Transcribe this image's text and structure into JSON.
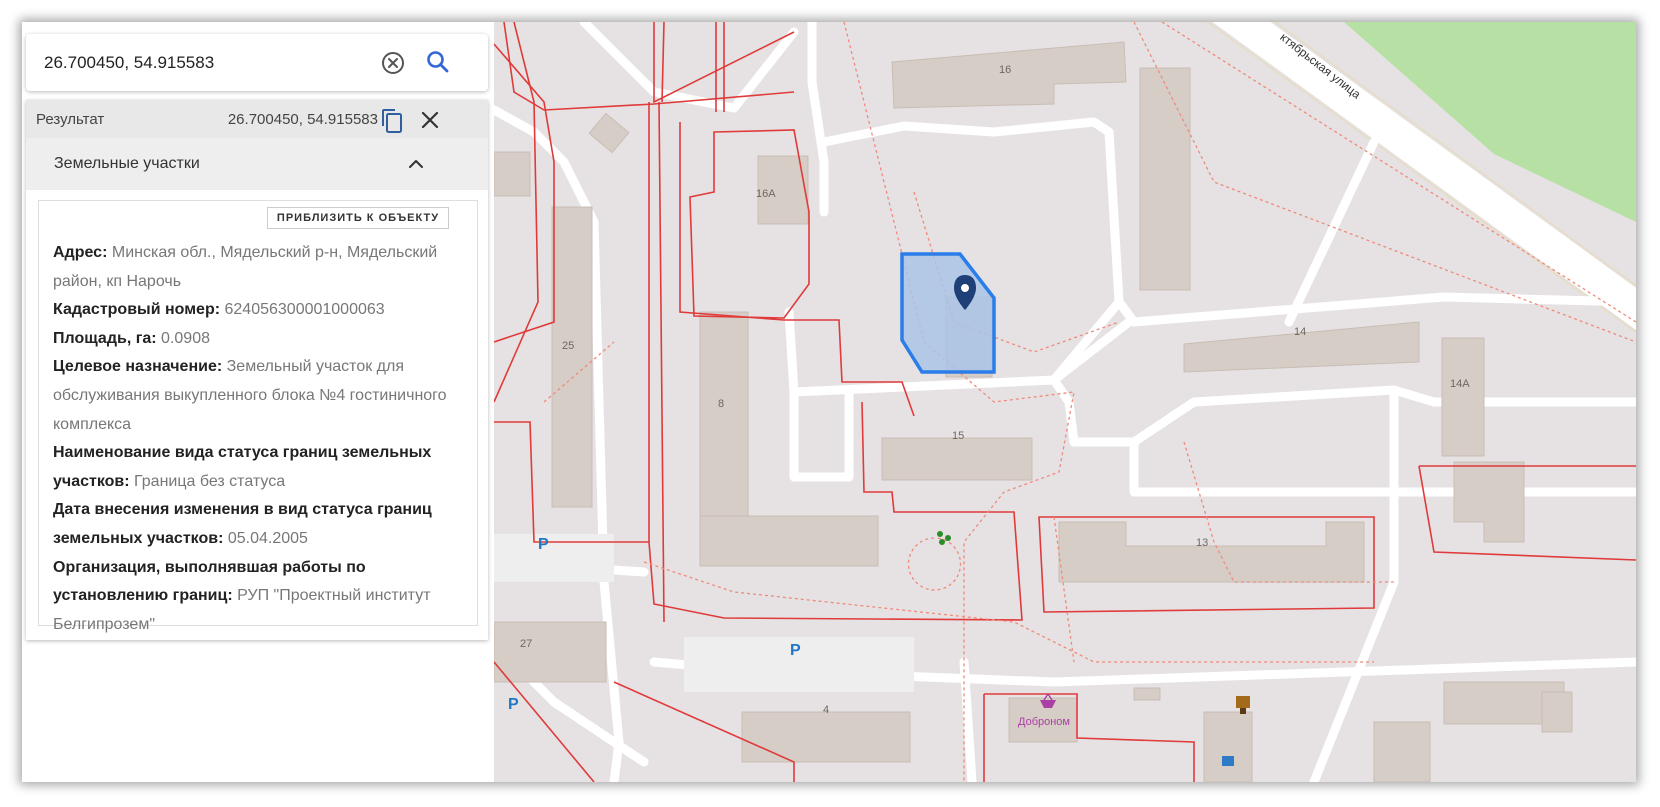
{
  "search": {
    "value": "26.700450, 54.915583",
    "placeholder": "26.700450, 54.915583"
  },
  "result": {
    "title": "Результат",
    "coords": "26.700450, 54.915583"
  },
  "section": {
    "title": "Земельные участки",
    "zoom_button": "ПРИБЛИЗИТЬ К ОБЪЕКТУ"
  },
  "parcel": {
    "address_label": "Адрес:",
    "address_value": "Минская обл., Мядельский р-н, Мядельский район, кп Нарочь",
    "cadastral_label": "Кадастровый номер:",
    "cadastral_value": "624056300001000063",
    "area_label": "Площадь, га:",
    "area_value": "0.0908",
    "purpose_label": "Целевое назначение:",
    "purpose_value": "Земельный участок для обслуживания выкупленного блока №4 гостиничного комплекса",
    "status_label": "Наименование вида статуса границ земельных участков:",
    "status_value": "Граница без статуса",
    "date_label": "Дата внесения изменения в вид статуса границ земельных участков:",
    "date_value": "05.04.2005",
    "org_label": "Организация, выполнявшая работы по установлению границ:",
    "org_value": "РУП \"Проектный институт Белгипрозем\""
  },
  "map": {
    "street": "ктябрьская улица",
    "buildings": [
      "16",
      "16А",
      "25",
      "8",
      "15",
      "14",
      "14А",
      "13",
      "27",
      "4"
    ],
    "parking": "P",
    "shop": "Доброном"
  },
  "colors": {
    "accent": "#3367d6",
    "parcel_fill": "#a9c4e6",
    "parcel_stroke": "#2b7de9",
    "boundary": "#e03a3a",
    "building": "#d6cdc6",
    "park": "#b7e0a5",
    "marker": "#1e3f78"
  }
}
